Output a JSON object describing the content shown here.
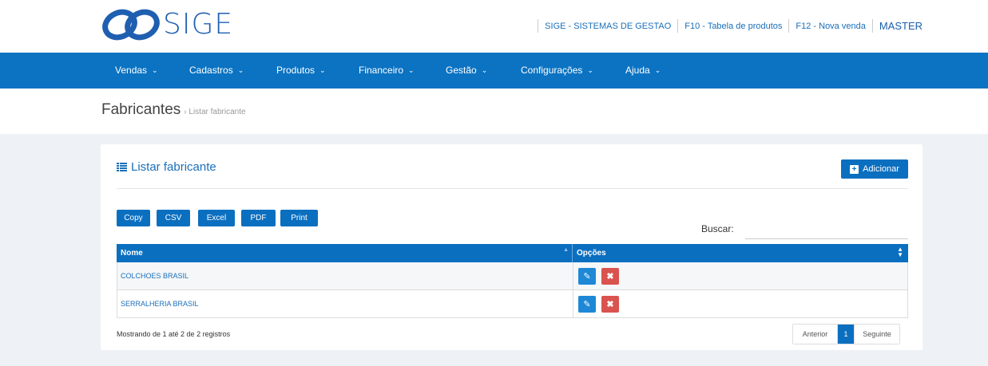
{
  "brand": {
    "name": "SIGE"
  },
  "toplinks": {
    "company": "SIGE - SISTEMAS DE GESTAO",
    "f10": "F10 - Tabela de produtos",
    "f12": "F12 - Nova venda",
    "user": "MASTER"
  },
  "nav": [
    "Vendas",
    "Cadastros",
    "Produtos",
    "Financeiro",
    "Gestão",
    "Configurações",
    "Ajuda"
  ],
  "breadcrumb": {
    "title": "Fabricantes",
    "sub": "› Listar fabricante"
  },
  "panel": {
    "title": "Listar fabricante",
    "add_label": "Adicionar",
    "export": [
      "Copy",
      "CSV",
      "Excel",
      "PDF",
      "Print"
    ],
    "search_label": "Buscar:",
    "search_value": ""
  },
  "table": {
    "columns": [
      "Nome",
      "Opções"
    ],
    "rows": [
      {
        "nome": "COLCHOES BRASIL"
      },
      {
        "nome": "SERRALHERIA BRASIL"
      }
    ]
  },
  "footer": {
    "info": "Mostrando de 1 até 2 de 2 registros",
    "prev": "Anterior",
    "page": "1",
    "next": "Seguinte"
  },
  "colors": {
    "primary": "#0b73c2",
    "danger": "#d9534f",
    "edit": "#1e88d6"
  }
}
